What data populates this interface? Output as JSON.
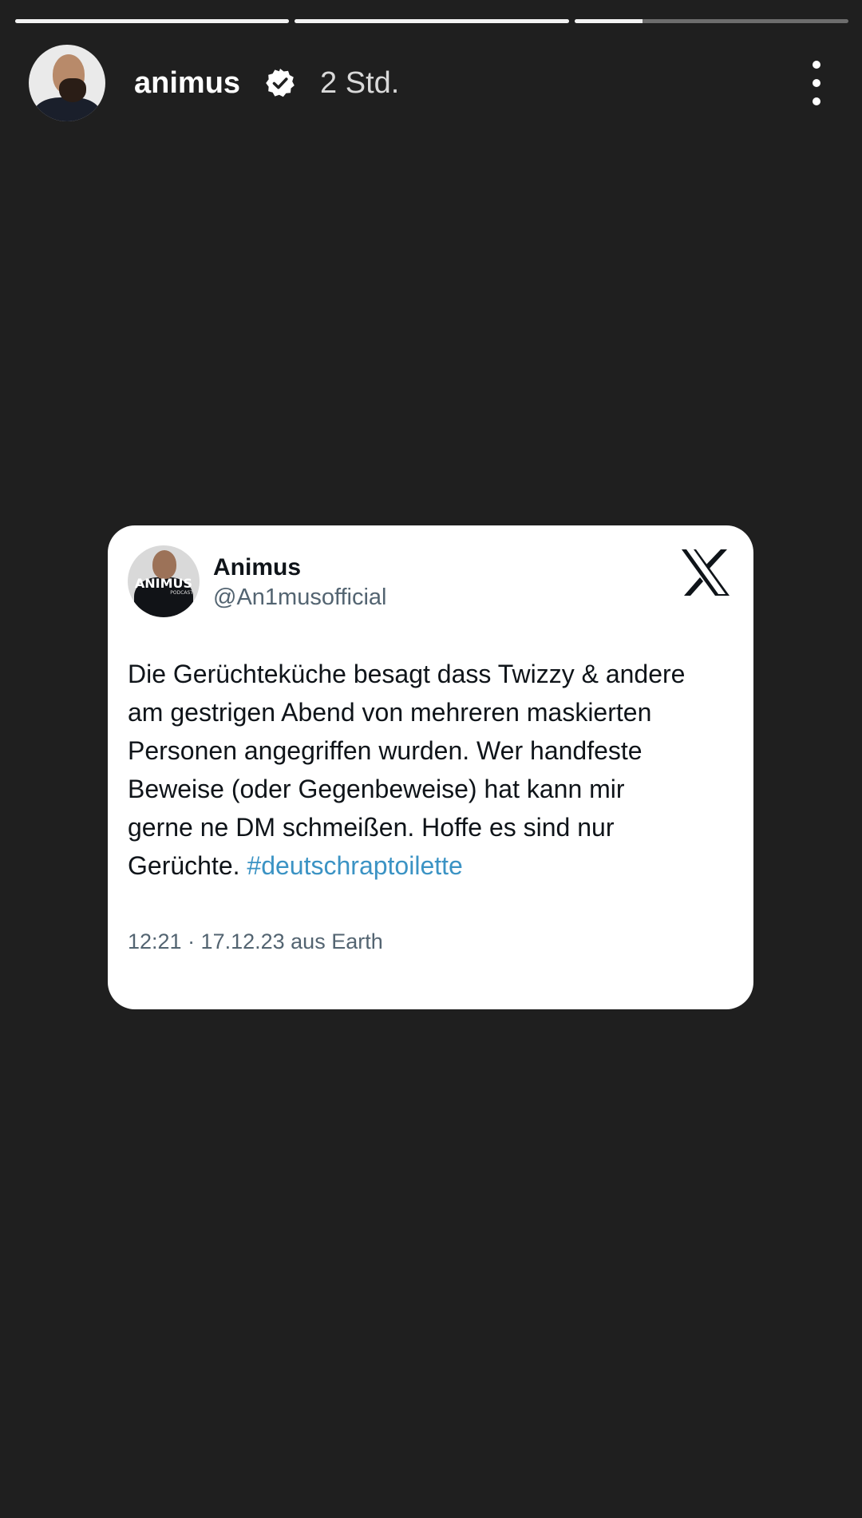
{
  "progress": {
    "segments": [
      1.0,
      1.0,
      0.25
    ]
  },
  "header": {
    "username": "animus",
    "verified": true,
    "time": "2 Std.",
    "menu_icon": "more-vertical-icon"
  },
  "tweet": {
    "name": "Animus",
    "handle": "@An1musofficial",
    "avatar_logo": "ANIMUS",
    "avatar_logo_sub": "PODCAST",
    "brand_icon": "x-logo-icon",
    "text": "Die Gerüchteküche besagt dass Twizzy & andere\nam gestrigen Abend von mehreren maskierten\nPersonen angegriffen wurden. Wer handfeste\nBeweise (oder Gegenbeweise) hat kann mir\ngerne ne DM schmeißen. Hoffe es sind nur\nGerüchte.",
    "hashtag": "#deutschraptoilette",
    "meta": "12:21 · 17.12.23 aus Earth"
  },
  "colors": {
    "background": "#1f1f1f",
    "hashtag": "#3b93c4",
    "meta_text": "#536471"
  }
}
